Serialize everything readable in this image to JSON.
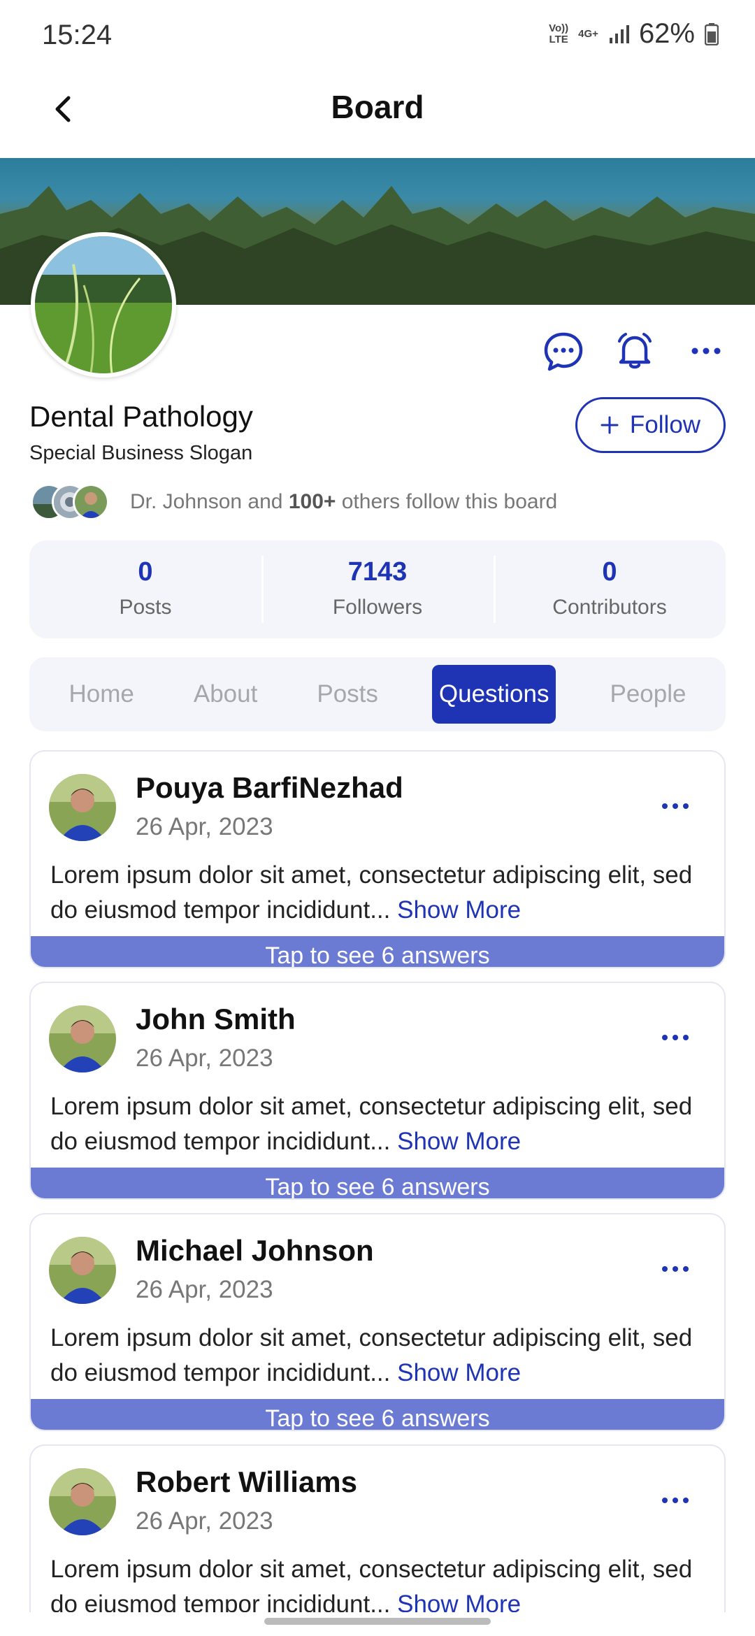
{
  "status_bar": {
    "time": "15:24",
    "network_volte": "Vo))\nLTE",
    "network_4g": "4G+",
    "battery": "62%"
  },
  "app_bar": {
    "title": "Board",
    "back_icon": "chevron-left-icon"
  },
  "board": {
    "name": "Dental Pathology",
    "slogan": "Special Business Slogan",
    "follow_label": "Follow",
    "followers_summary_prefix": "Dr. Johnson and ",
    "followers_summary_bold": "100+",
    "followers_summary_suffix": " others follow this board",
    "actions": [
      "chat-icon",
      "bell-icon",
      "more-horizontal-icon"
    ]
  },
  "stats": [
    {
      "value": "0",
      "label": "Posts"
    },
    {
      "value": "7143",
      "label": "Followers"
    },
    {
      "value": "0",
      "label": "Contributors"
    }
  ],
  "tabs": [
    {
      "label": "Home",
      "active": false
    },
    {
      "label": "About",
      "active": false
    },
    {
      "label": "Posts",
      "active": false
    },
    {
      "label": "Questions",
      "active": true
    },
    {
      "label": "People",
      "active": false
    }
  ],
  "questions": [
    {
      "author": "Pouya BarfiNezhad",
      "date": "26 Apr, 2023",
      "body": "Lorem ipsum dolor sit amet, consectetur adipiscing elit, sed do eiusmod tempor incididunt...",
      "show_more": "Show More",
      "answers": "Tap to see 6 answers"
    },
    {
      "author": "John Smith",
      "date": "26 Apr, 2023",
      "body": "Lorem ipsum dolor sit amet, consectetur adipiscing elit, sed do eiusmod tempor incididunt...",
      "show_more": "Show More",
      "answers": "Tap to see 6 answers"
    },
    {
      "author": "Michael Johnson",
      "date": "26 Apr, 2023",
      "body": "Lorem ipsum dolor sit amet, consectetur adipiscing elit, sed do eiusmod tempor incididunt...",
      "show_more": "Show More",
      "answers": "Tap to see 6 answers"
    },
    {
      "author": "Robert Williams",
      "date": "26 Apr, 2023",
      "body": "Lorem ipsum dolor sit amet, consectetur adipiscing elit, sed do eiusmod tempor incididunt...",
      "show_more": "Show More",
      "answers": ""
    }
  ],
  "colors": {
    "accent": "#1f34b5",
    "answers_bar": "#6b7bd3",
    "panel_bg": "#f4f5fa"
  }
}
